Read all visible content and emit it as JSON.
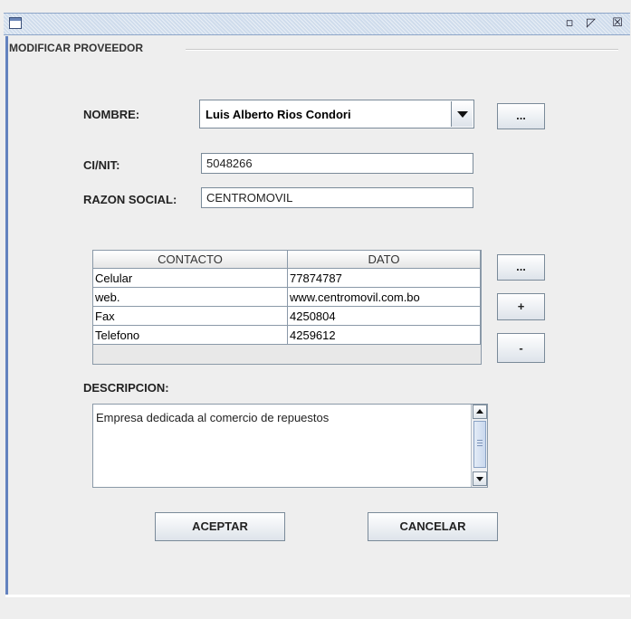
{
  "window": {
    "title_buttons": [
      {
        "icon": "minimize-icon",
        "glyph": "▫"
      },
      {
        "icon": "maximize-icon",
        "glyph": "◸"
      },
      {
        "icon": "close-icon",
        "glyph": "☒"
      }
    ]
  },
  "form": {
    "title": "MODIFICAR PROVEEDOR",
    "nombre_label": "NOMBRE:",
    "nombre_value": "Luis Alberto Rios Condori",
    "nombre_browse_label": "...",
    "ci_label": "CI/NIT:",
    "ci_value": "5048266",
    "razon_label": "RAZON SOCIAL:",
    "razon_value": "CENTROMOVIL",
    "descripcion_label": "DESCRIPCION:",
    "descripcion_value": "Empresa dedicada al comercio de repuestos"
  },
  "contacts": {
    "headers": [
      "CONTACTO",
      "DATO"
    ],
    "rows": [
      [
        "Celular",
        "77874787"
      ],
      [
        "web.",
        "www.centromovil.com.bo"
      ],
      [
        "Fax",
        "4250804"
      ],
      [
        "Telefono",
        "4259612"
      ]
    ],
    "buttons": {
      "browse": "...",
      "add": "+",
      "remove": "-"
    }
  },
  "actions": {
    "accept": "ACEPTAR",
    "cancel": "CANCELAR"
  }
}
